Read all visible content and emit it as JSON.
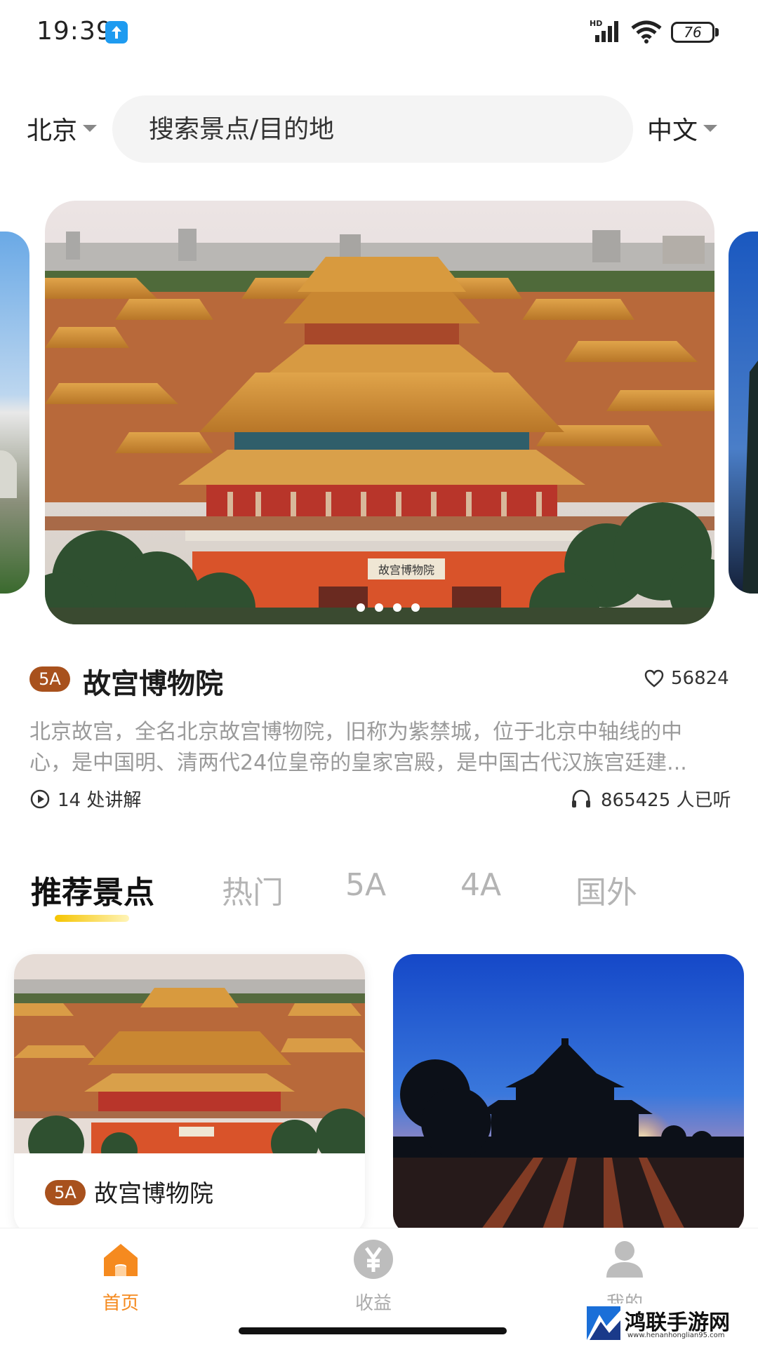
{
  "status_bar": {
    "time": "19:39",
    "network_label": "HD",
    "battery": "76"
  },
  "header": {
    "city": "北京",
    "search_placeholder": "搜索景点/目的地",
    "language": "中文"
  },
  "carousel": {
    "slides": 4,
    "active_index": 3,
    "plaque_text": "故宫博物院"
  },
  "featured": {
    "grade": "5A",
    "title": "故宫博物院",
    "likes": "56824",
    "description_line1": "北京故宫，全名北京故宫博物院，旧称为紫禁城，位于北京中轴线的中",
    "description_line2": "心，是中国明、清两代24位皇帝的皇家宫殿，是中国古代汉族宫廷建...",
    "audio_points": "14 处讲解",
    "listeners": "865425 人已听"
  },
  "tabs": [
    {
      "label": "推荐景点",
      "active": true
    },
    {
      "label": "热门",
      "active": false
    },
    {
      "label": "5A",
      "active": false
    },
    {
      "label": "4A",
      "active": false
    },
    {
      "label": "国外",
      "active": false
    }
  ],
  "cards": [
    {
      "grade": "5A",
      "title": "故宫博物院"
    }
  ],
  "bottom_nav": [
    {
      "label": "首页",
      "icon": "home-icon",
      "active": true
    },
    {
      "label": "收益",
      "icon": "yen-icon",
      "active": false
    },
    {
      "label": "我的",
      "icon": "user-icon",
      "active": false
    }
  ],
  "watermark": {
    "name": "鸿联手游网",
    "url": "www.henanhonglian95.com"
  },
  "colors": {
    "accent": "#f58a1f",
    "badge": "#a8511d",
    "tab_indicator": "#f5c400",
    "muted_text": "#9a9a9a"
  }
}
